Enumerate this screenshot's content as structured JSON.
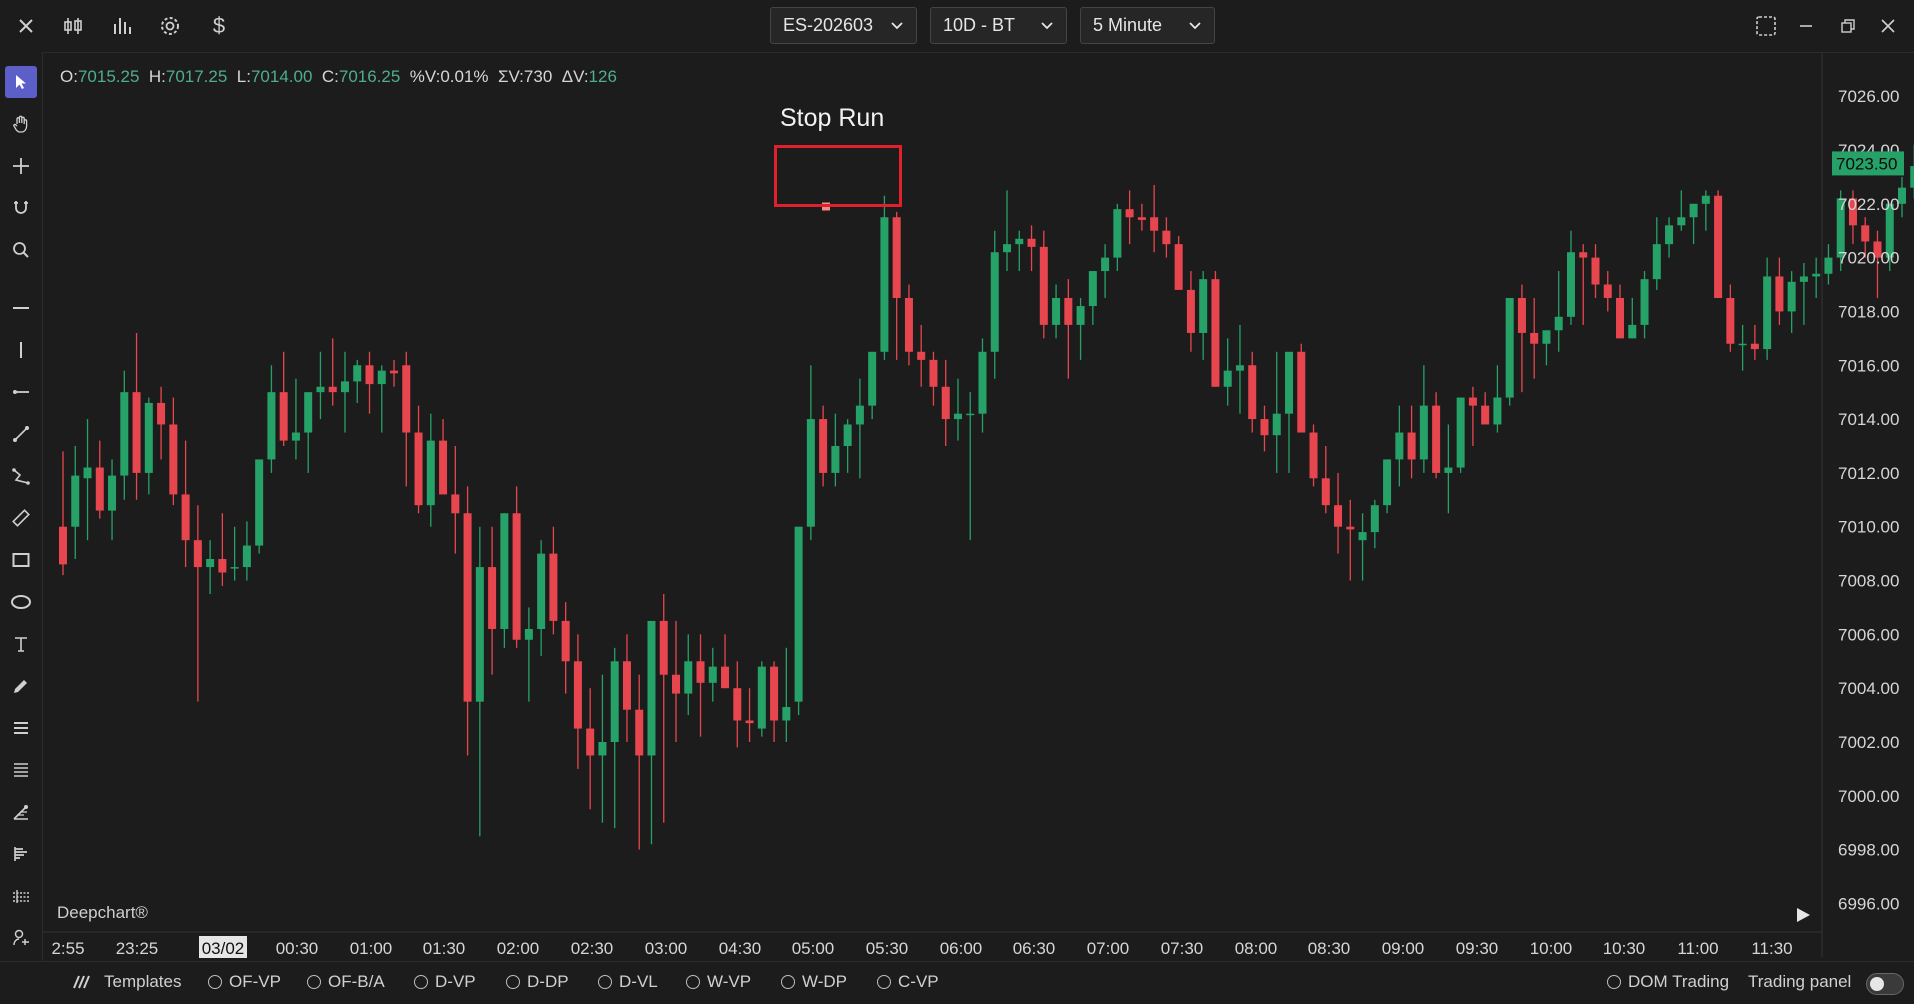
{
  "toolbar": {
    "symbol": "ES-202603",
    "data_range": "10D - BT",
    "interval": "5 Minute"
  },
  "ohlc": {
    "o_label": "O:",
    "o": "7015.25",
    "h_label": "H:",
    "h": "7017.25",
    "l_label": "L:",
    "l": "7014.00",
    "c_label": "C:",
    "c": "7016.25",
    "pv_label": "%V:",
    "pv": "0.01%",
    "sv_label": "ΣV:",
    "sv": "730",
    "dv_label": "ΔV:",
    "dv": "126"
  },
  "annotation": {
    "label": "Stop Run"
  },
  "watermark": "Deepchart®",
  "bottom_bar": {
    "templates_label": "Templates",
    "studies": [
      "OF-VP",
      "OF-B/A",
      "D-VP",
      "D-DP",
      "D-VL",
      "W-VP",
      "W-DP",
      "C-VP"
    ],
    "dom_trading": "DOM Trading",
    "trading_panel": "Trading panel"
  },
  "colors": {
    "up": "#26a269",
    "down": "#e8464e",
    "background": "#1c1c1c",
    "price_label": "#26a269",
    "annotation_box": "#e0202a"
  },
  "chart_data": {
    "type": "candlestick",
    "x_tick_labels": [
      "2:55",
      "23:25",
      "03/02",
      "00:30",
      "01:00",
      "01:30",
      "02:00",
      "02:30",
      "03:00",
      "04:30",
      "05:00",
      "05:30",
      "06:00",
      "06:30",
      "07:00",
      "07:30",
      "08:00",
      "08:30",
      "09:00",
      "09:30",
      "10:00",
      "10:30",
      "11:00",
      "11:30"
    ],
    "y_tick_labels": [
      "7026.00",
      "7024.00",
      "7022.00",
      "7020.00",
      "7018.00",
      "7016.00",
      "7014.00",
      "7012.00",
      "7010.00",
      "7008.00",
      "7006.00",
      "7004.00",
      "7002.00",
      "7000.00",
      "6998.00",
      "6996.00"
    ],
    "y_ticks": [
      7026,
      7024,
      7022,
      7020,
      7018,
      7016,
      7014,
      7012,
      7010,
      7008,
      7006,
      7004,
      7002,
      7000,
      6998,
      6996
    ],
    "ylim": [
      6995.2,
      7026.6
    ],
    "current_price": 7023.5,
    "current_price_label": "7023.50",
    "stop_run_marker_price": 7021.9,
    "candles": [
      [
        7010.0,
        7012.8,
        7008.2,
        7008.6
      ],
      [
        7010.0,
        7013.0,
        7008.8,
        7011.9
      ],
      [
        7011.8,
        7014.0,
        7009.5,
        7012.2
      ],
      [
        7012.2,
        7013.2,
        7010.3,
        7010.6
      ],
      [
        7010.6,
        7012.5,
        7009.5,
        7011.9
      ],
      [
        7011.9,
        7015.8,
        7011.0,
        7015.0
      ],
      [
        7015.0,
        7017.2,
        7011.0,
        7012.0
      ],
      [
        7012.0,
        7014.8,
        7011.2,
        7014.6
      ],
      [
        7014.6,
        7015.2,
        7012.5,
        7013.8
      ],
      [
        7013.8,
        7014.8,
        7010.8,
        7011.2
      ],
      [
        7011.2,
        7013.2,
        7008.5,
        7009.5
      ],
      [
        7009.5,
        7010.8,
        7003.5,
        7008.5
      ],
      [
        7008.5,
        7009.5,
        7007.5,
        7008.8
      ],
      [
        7008.8,
        7010.5,
        7007.8,
        7008.3
      ],
      [
        7008.5,
        7010.0,
        7008.0,
        7008.5
      ],
      [
        7008.5,
        7010.2,
        7008.0,
        7009.3
      ],
      [
        7009.3,
        7012.0,
        7009.0,
        7012.5
      ],
      [
        7012.5,
        7016.0,
        7012.0,
        7015.0
      ],
      [
        7015.0,
        7016.5,
        7013.0,
        7013.2
      ],
      [
        7013.2,
        7015.5,
        7012.5,
        7013.5
      ],
      [
        7013.5,
        7015.0,
        7012.0,
        7015.0
      ],
      [
        7015.0,
        7016.5,
        7014.0,
        7015.2
      ],
      [
        7015.2,
        7017.0,
        7014.5,
        7015.0
      ],
      [
        7015.0,
        7016.5,
        7013.5,
        7015.4
      ],
      [
        7015.4,
        7016.2,
        7014.6,
        7016.0
      ],
      [
        7016.0,
        7016.5,
        7014.2,
        7015.3
      ],
      [
        7015.3,
        7016.0,
        7013.5,
        7015.8
      ],
      [
        7015.8,
        7016.2,
        7015.2,
        7015.7
      ],
      [
        7016.0,
        7016.5,
        7011.5,
        7013.5
      ],
      [
        7013.5,
        7014.5,
        7010.5,
        7010.8
      ],
      [
        7010.8,
        7014.2,
        7010.0,
        7013.2
      ],
      [
        7013.2,
        7014.0,
        7011.2,
        7011.2
      ],
      [
        7011.2,
        7013.0,
        7009.0,
        7010.5
      ],
      [
        7010.5,
        7011.5,
        7001.5,
        7003.5
      ],
      [
        7003.5,
        7010.0,
        6998.5,
        7008.5
      ],
      [
        7008.5,
        7010.0,
        7004.5,
        7006.2
      ],
      [
        7006.2,
        7010.5,
        7005.5,
        7010.5
      ],
      [
        7010.5,
        7011.5,
        7005.5,
        7005.8
      ],
      [
        7005.8,
        7007.0,
        7003.5,
        7006.2
      ],
      [
        7006.2,
        7009.5,
        7005.2,
        7009.0
      ],
      [
        7009.0,
        7010.0,
        7006.0,
        7006.5
      ],
      [
        7006.5,
        7007.2,
        7003.8,
        7005.0
      ],
      [
        7005.0,
        7006.0,
        7001.0,
        7002.5
      ],
      [
        7002.5,
        7004.0,
        6999.5,
        7001.5
      ],
      [
        7001.5,
        7004.5,
        6999.0,
        7002.0
      ],
      [
        7002.0,
        7005.5,
        6998.8,
        7005.0
      ],
      [
        7005.0,
        7006.0,
        7002.0,
        7003.2
      ],
      [
        7003.2,
        7004.5,
        6998.0,
        7001.5
      ],
      [
        7001.5,
        7005.0,
        6998.2,
        7006.5
      ],
      [
        7006.5,
        7007.5,
        6999.0,
        7004.5
      ],
      [
        7004.5,
        7006.5,
        7002.0,
        7003.8
      ],
      [
        7003.8,
        7006.0,
        7003.0,
        7005.0
      ],
      [
        7005.0,
        7006.0,
        7002.2,
        7004.2
      ],
      [
        7004.2,
        7005.5,
        7003.5,
        7004.8
      ],
      [
        7004.8,
        7006.0,
        7004.2,
        7004.0
      ],
      [
        7004.0,
        7005.0,
        7001.8,
        7002.8
      ],
      [
        7002.8,
        7004.0,
        7002.0,
        7002.7
      ],
      [
        7002.5,
        7005.0,
        7002.2,
        7004.8
      ],
      [
        7004.8,
        7005.0,
        7002.0,
        7002.8
      ],
      [
        7002.8,
        7005.5,
        7002.0,
        7003.3
      ],
      [
        7003.5,
        7010.0,
        7003.0,
        7010.0
      ],
      [
        7010.0,
        7016.0,
        7009.5,
        7014.0
      ],
      [
        7014.0,
        7014.5,
        7011.5,
        7012.0
      ],
      [
        7012.0,
        7014.2,
        7011.5,
        7013.0
      ],
      [
        7013.0,
        7014.0,
        7012.0,
        7013.8
      ],
      [
        7013.8,
        7015.5,
        7011.8,
        7014.5
      ],
      [
        7014.5,
        7016.0,
        7014.0,
        7016.5
      ],
      [
        7016.5,
        7022.3,
        7016.2,
        7021.5
      ],
      [
        7021.5,
        7021.7,
        7016.2,
        7018.5
      ],
      [
        7018.5,
        7019.0,
        7016.0,
        7016.5
      ],
      [
        7016.5,
        7017.5,
        7015.2,
        7016.2
      ],
      [
        7016.2,
        7016.5,
        7014.5,
        7015.2
      ],
      [
        7015.2,
        7016.2,
        7013.0,
        7014.0
      ],
      [
        7014.0,
        7015.5,
        7013.2,
        7014.2
      ],
      [
        7014.2,
        7015.0,
        7009.5,
        7014.2
      ],
      [
        7014.2,
        7017.0,
        7013.5,
        7016.5
      ],
      [
        7016.5,
        7021.0,
        7015.5,
        7020.2
      ],
      [
        7020.2,
        7022.5,
        7019.5,
        7020.5
      ],
      [
        7020.5,
        7021.0,
        7019.5,
        7020.7
      ],
      [
        7020.7,
        7021.2,
        7019.5,
        7020.4
      ],
      [
        7020.4,
        7021.0,
        7017.0,
        7017.5
      ],
      [
        7017.5,
        7019.0,
        7017.0,
        7018.5
      ],
      [
        7018.5,
        7019.2,
        7015.5,
        7017.5
      ],
      [
        7017.5,
        7018.5,
        7016.2,
        7018.2
      ],
      [
        7018.2,
        7019.5,
        7017.5,
        7019.5
      ],
      [
        7019.5,
        7020.5,
        7018.5,
        7020.0
      ],
      [
        7020.0,
        7022.0,
        7019.5,
        7021.8
      ],
      [
        7021.8,
        7022.5,
        7020.5,
        7021.5
      ],
      [
        7021.5,
        7022.0,
        7021.0,
        7021.4
      ],
      [
        7021.5,
        7022.7,
        7020.2,
        7021.0
      ],
      [
        7021.0,
        7021.5,
        7020.0,
        7020.5
      ],
      [
        7020.5,
        7020.8,
        7018.8,
        7018.8
      ],
      [
        7018.8,
        7019.5,
        7016.5,
        7017.2
      ],
      [
        7017.2,
        7019.5,
        7016.2,
        7019.2
      ],
      [
        7019.2,
        7019.5,
        7015.2,
        7015.2
      ],
      [
        7015.2,
        7017.0,
        7014.5,
        7015.8
      ],
      [
        7015.8,
        7017.5,
        7014.2,
        7016.0
      ],
      [
        7016.0,
        7016.5,
        7013.5,
        7014.0
      ],
      [
        7014.0,
        7014.5,
        7012.8,
        7013.4
      ],
      [
        7013.4,
        7016.5,
        7012.0,
        7014.2
      ],
      [
        7014.2,
        7016.0,
        7012.0,
        7016.5
      ],
      [
        7016.5,
        7016.8,
        7013.5,
        7013.5
      ],
      [
        7013.5,
        7013.8,
        7011.5,
        7011.8
      ],
      [
        7011.8,
        7013.0,
        7010.5,
        7010.8
      ],
      [
        7010.8,
        7012.0,
        7009.0,
        7010.0
      ],
      [
        7010.0,
        7011.0,
        7008.0,
        7009.9
      ],
      [
        7009.5,
        7010.5,
        7008.0,
        7009.8
      ],
      [
        7009.8,
        7011.0,
        7009.2,
        7010.8
      ],
      [
        7010.8,
        7012.5,
        7010.5,
        7012.5
      ],
      [
        7012.5,
        7014.5,
        7011.5,
        7013.5
      ],
      [
        7013.5,
        7014.5,
        7011.8,
        7012.5
      ],
      [
        7012.5,
        7016.0,
        7012.0,
        7014.5
      ],
      [
        7014.5,
        7015.0,
        7011.8,
        7012.0
      ],
      [
        7012.0,
        7013.8,
        7010.5,
        7012.2
      ],
      [
        7012.2,
        7014.5,
        7012.0,
        7014.8
      ],
      [
        7014.8,
        7015.2,
        7013.0,
        7014.5
      ],
      [
        7014.5,
        7015.0,
        7013.8,
        7013.8
      ],
      [
        7013.8,
        7016.0,
        7013.5,
        7014.8
      ],
      [
        7014.8,
        7016.5,
        7014.5,
        7018.5
      ],
      [
        7018.5,
        7019.0,
        7015.0,
        7017.2
      ],
      [
        7017.2,
        7018.5,
        7015.5,
        7016.8
      ],
      [
        7016.8,
        7017.2,
        7016.0,
        7017.3
      ],
      [
        7017.3,
        7019.5,
        7016.5,
        7017.8
      ],
      [
        7017.8,
        7021.0,
        7017.5,
        7020.2
      ],
      [
        7020.2,
        7020.5,
        7017.5,
        7020.0
      ],
      [
        7020.0,
        7020.5,
        7018.5,
        7019.0
      ],
      [
        7019.0,
        7019.5,
        7018.0,
        7018.5
      ],
      [
        7018.5,
        7019.0,
        7017.0,
        7017.0
      ],
      [
        7017.0,
        7018.5,
        7017.0,
        7017.5
      ],
      [
        7017.5,
        7019.5,
        7017.0,
        7019.2
      ],
      [
        7019.2,
        7021.5,
        7018.8,
        7020.5
      ],
      [
        7020.5,
        7021.5,
        7020.0,
        7021.2
      ],
      [
        7021.2,
        7022.5,
        7021.0,
        7021.5
      ],
      [
        7021.5,
        7022.0,
        7020.5,
        7022.0
      ],
      [
        7022.0,
        7022.5,
        7021.0,
        7022.3
      ],
      [
        7022.3,
        7022.5,
        7018.5,
        7018.5
      ],
      [
        7018.5,
        7019.0,
        7016.5,
        7016.8
      ],
      [
        7016.8,
        7017.5,
        7015.8,
        7016.8
      ],
      [
        7016.8,
        7017.5,
        7016.2,
        7016.6
      ],
      [
        7016.6,
        7020.0,
        7016.2,
        7019.3
      ],
      [
        7019.3,
        7020.0,
        7017.5,
        7018.0
      ],
      [
        7018.0,
        7019.5,
        7017.2,
        7019.1
      ],
      [
        7019.1,
        7019.8,
        7017.5,
        7019.3
      ],
      [
        7019.3,
        7020.0,
        7018.5,
        7019.4
      ],
      [
        7019.4,
        7020.5,
        7019.0,
        7020.0
      ],
      [
        7020.0,
        7022.5,
        7019.5,
        7022.2
      ],
      [
        7022.2,
        7022.5,
        7020.5,
        7021.2
      ],
      [
        7021.2,
        7021.5,
        7020.0,
        7020.6
      ],
      [
        7020.6,
        7021.0,
        7018.5,
        7020.0
      ],
      [
        7020.0,
        7022.0,
        7019.5,
        7022.0
      ],
      [
        7022.0,
        7023.0,
        7021.5,
        7022.6
      ],
      [
        7022.6,
        7024.2,
        7022.2,
        7023.4
      ]
    ]
  }
}
